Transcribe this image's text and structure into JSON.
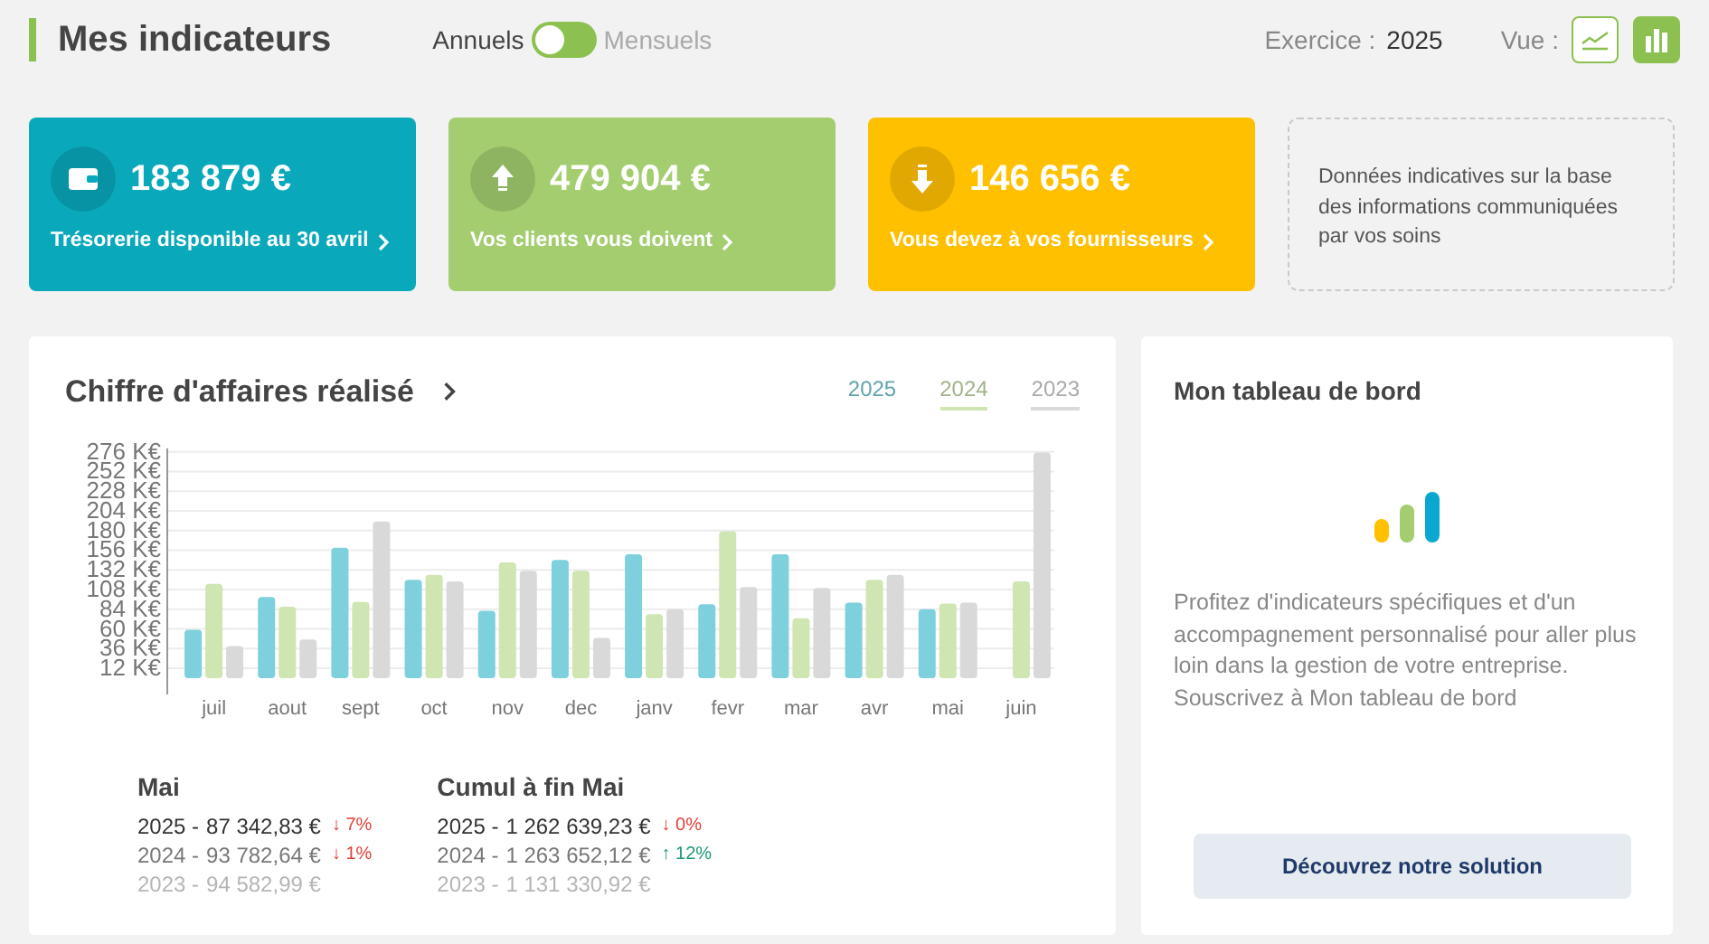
{
  "header": {
    "title": "Mes indicateurs",
    "toggle": {
      "left_label": "Annuels",
      "right_label": "Mensuels",
      "on": false
    },
    "exercise_label": "Exercice :",
    "exercise_value": "2025",
    "view_label": "Vue :",
    "views": [
      {
        "kind": "line",
        "selected": false
      },
      {
        "kind": "bar",
        "selected": true
      }
    ]
  },
  "kpis": [
    {
      "kind": "wallet",
      "color": "#0aa8bb",
      "amount": "183 879 €",
      "label": "Trésorerie disponible au 30 avril"
    },
    {
      "kind": "up",
      "color": "#a3cd6f",
      "amount": "479 904 €",
      "label": "Vos clients vous doivent"
    },
    {
      "kind": "down",
      "color": "#ffc000",
      "amount": "146 656 €",
      "label": "Vous devez à vos fournisseurs"
    }
  ],
  "notice": "Données indicatives sur la base des informations communiquées par vos soins",
  "revenue": {
    "title": "Chiffre d'affaires réalisé",
    "chart_data": {
      "type": "bar",
      "grid": true,
      "categories": [
        "juil",
        "aout",
        "sept",
        "oct",
        "nov",
        "dec",
        "janv",
        "fevr",
        "mar",
        "avr",
        "mai",
        "juin"
      ],
      "ylim": [
        0,
        280
      ],
      "yticks": [
        {
          "value": 12,
          "label": "12 K€"
        },
        {
          "value": 36,
          "label": "36 K€"
        },
        {
          "value": 60,
          "label": "60 K€"
        },
        {
          "value": 84,
          "label": "84 K€"
        },
        {
          "value": 108,
          "label": "108 K€"
        },
        {
          "value": 132,
          "label": "132 K€"
        },
        {
          "value": 156,
          "label": "156 K€"
        },
        {
          "value": 180,
          "label": "180 K€"
        },
        {
          "value": 204,
          "label": "204 K€"
        },
        {
          "value": 228,
          "label": "228 K€"
        },
        {
          "value": 252,
          "label": "252 K€"
        },
        {
          "value": 276,
          "label": "276 K€"
        }
      ],
      "series": [
        {
          "name": "2025",
          "color": "#7dd0dc",
          "values": [
            59,
            99,
            159,
            120,
            82,
            144,
            151,
            90,
            151,
            92,
            84,
            null
          ]
        },
        {
          "name": "2024",
          "color": "#cfe5b2",
          "values": [
            115,
            87,
            93,
            126,
            141,
            131,
            78,
            179,
            73,
            120,
            91,
            118
          ]
        },
        {
          "name": "2023",
          "color": "#d9d9d9",
          "values": [
            39,
            47,
            191,
            118,
            131,
            49,
            84,
            111,
            110,
            126,
            92,
            275
          ]
        }
      ]
    },
    "legend": [
      {
        "underlined": false
      },
      {
        "underlined": true
      },
      {
        "underlined": true
      }
    ],
    "summaries": [
      {
        "title": "Mai",
        "rows": [
          {
            "year": "2025 -",
            "amount": "87 342,83 €",
            "delta": {
              "arrow": "↓",
              "value": "7%",
              "color": "#e0403a"
            }
          },
          {
            "year": "2024 -",
            "amount": "93 782,64 €",
            "delta": {
              "arrow": "↓",
              "value": "1%",
              "color": "#e0403a"
            }
          },
          {
            "year": "2023 -",
            "amount": "94 582,99 €"
          }
        ]
      },
      {
        "title": "Cumul à fin Mai",
        "rows": [
          {
            "year": "2025 -",
            "amount": "1 262 639,23 €",
            "delta": {
              "arrow": "↓",
              "value": "0%",
              "color": "#e0403a"
            }
          },
          {
            "year": "2024 -",
            "amount": "1 263 652,12 €",
            "delta": {
              "arrow": "↑",
              "value": "12%",
              "color": "#1a9a7a"
            }
          },
          {
            "year": "2023 -",
            "amount": "1 131 330,92 €"
          }
        ]
      }
    ]
  },
  "dashboard": {
    "title": "Mon tableau de bord",
    "text": "Profitez d'indicateurs spécifiques et d'un accompagnement personnalisé pour aller plus loin dans la gestion de votre entreprise. Souscrivez à Mon tableau de bord",
    "button": "Découvrez notre solution"
  }
}
